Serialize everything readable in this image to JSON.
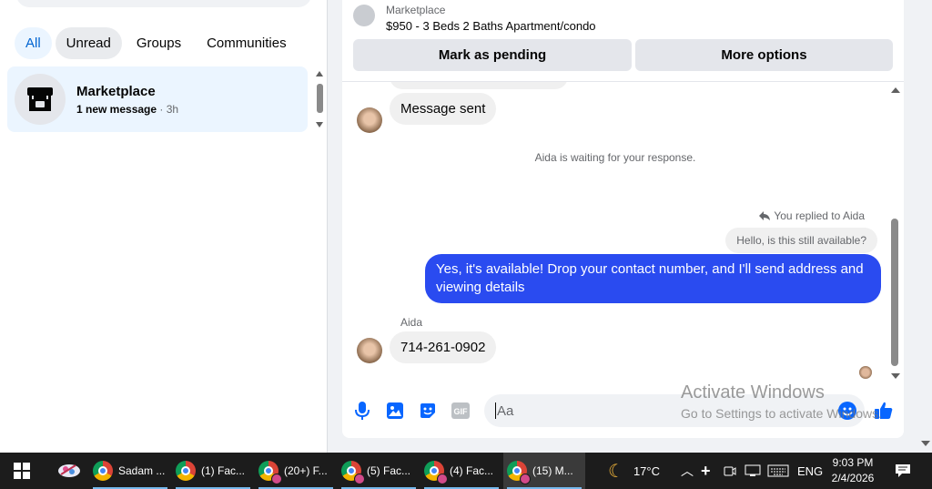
{
  "sidebar": {
    "filters": [
      {
        "label": "All",
        "active": true
      },
      {
        "label": "Unread"
      },
      {
        "label": "Groups"
      },
      {
        "label": "Communities"
      }
    ],
    "conversation": {
      "name": "Marketplace",
      "preview": "1 new message",
      "separator": " · ",
      "time": "3h",
      "icon": "store-icon"
    }
  },
  "listing": {
    "source_label": "Marketplace",
    "title": "$950 - 3 Beds 2 Baths Apartment/condo",
    "mark_pending_label": "Mark as pending",
    "more_options_label": "More options"
  },
  "messages": {
    "message_sent": "Message sent",
    "waiting": "Aida is waiting for your response.",
    "replied_note": "You replied to Aida",
    "quoted": "Hello, is this still available?",
    "outgoing": "Yes, it's available! Drop your contact number, and I'll send address and viewing details",
    "sender_name": "Aida",
    "phone": "714-261-0902"
  },
  "composer": {
    "placeholder": "Aa",
    "icons": [
      "microphone-icon",
      "image-icon",
      "sticker-icon",
      "gif-icon",
      "emoji-icon",
      "like-icon"
    ],
    "gif_label": "GIF"
  },
  "watermark": {
    "title": "Activate Windows",
    "subtitle": "Go to Settings to activate Windows."
  },
  "taskbar": {
    "apps": [
      {
        "label": "Sadam ...",
        "active": false
      },
      {
        "label": "(1) Fac...",
        "active": false
      },
      {
        "label": "(20+) F...",
        "active": false
      },
      {
        "label": "(5) Fac...",
        "active": false
      },
      {
        "label": "(4) Fac...",
        "active": false
      },
      {
        "label": "(15) M...",
        "active": true
      }
    ],
    "weather": "17°C",
    "language": "ENG",
    "time": "9:03 PM",
    "date": "2/4/2026"
  },
  "colors": {
    "accent": "#2a4bf0",
    "active_chip_text": "#0064d1",
    "selected_row": "#ebf5ff",
    "taskbar": "#1c1c1c"
  }
}
